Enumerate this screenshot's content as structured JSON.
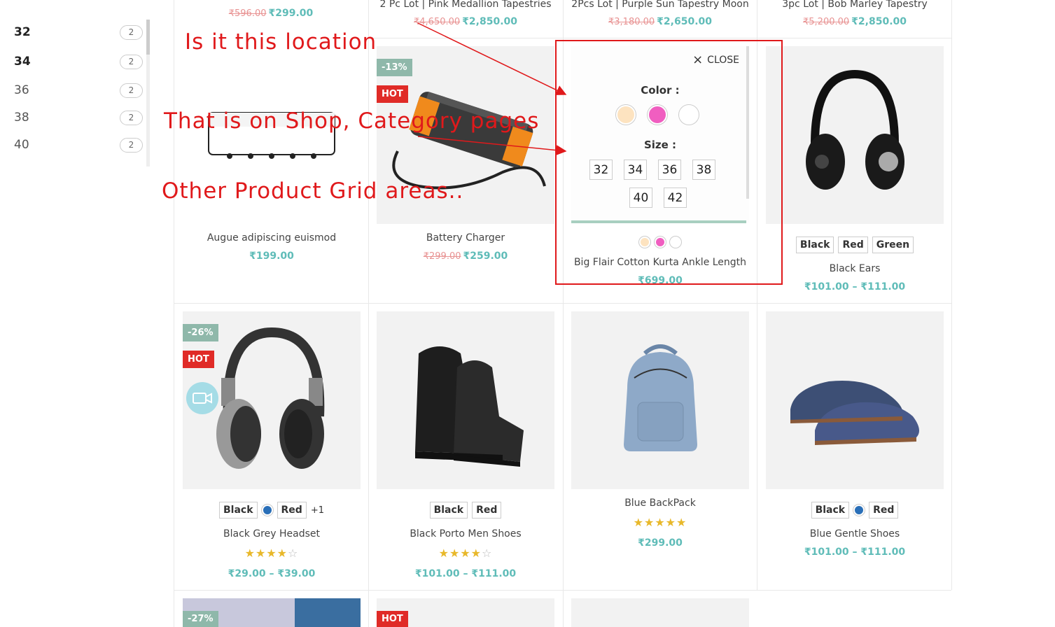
{
  "sidebar": {
    "sizes": [
      {
        "label": "32",
        "count": "2"
      },
      {
        "label": "34",
        "count": "2"
      },
      {
        "label": "36",
        "count": "2"
      },
      {
        "label": "38",
        "count": "2"
      },
      {
        "label": "40",
        "count": "2"
      }
    ]
  },
  "top_row": [
    {
      "name": "",
      "old_price": "₹596.00",
      "price": "₹299.00"
    },
    {
      "name": "2 Pc Lot | Pink Medallion Tapestries",
      "old_price": "₹4,650.00",
      "price": "₹2,850.00"
    },
    {
      "name": "2Pcs Lot | Purple Sun Tapestry Moon",
      "old_price": "₹3,180.00",
      "price": "₹2,650.00"
    },
    {
      "name": "3pc Lot | Bob Marley Tapestry",
      "old_price": "₹5,200.00",
      "price": "₹2,850.00"
    }
  ],
  "row2": [
    {
      "name": "Augue adipiscing euismod",
      "old_price": "",
      "price": "₹199.00"
    },
    {
      "name": "Battery Charger",
      "badge_discount": "-13%",
      "badge_hot": "HOT",
      "old_price": "₹299.00",
      "price": "₹259.00"
    },
    {
      "name": "Big Flair Cotton Kurta Ankle Length",
      "price": "₹699.00",
      "swatch_colors": [
        "#fde3c0",
        "#f05ec0",
        "#ffffff"
      ]
    },
    {
      "name": "Black Ears",
      "swatches": [
        "Black",
        "Red",
        "Green"
      ],
      "price": "₹101.00 – ₹111.00"
    }
  ],
  "quick_view": {
    "close_label": "CLOSE",
    "color_label": "Color :",
    "size_label": "Size :",
    "colors": [
      "#fde3c0",
      "#f05ec0",
      "#ffffff"
    ],
    "sizes": [
      "32",
      "34",
      "36",
      "38",
      "40",
      "42"
    ]
  },
  "row3": [
    {
      "name": "Black Grey Headset",
      "badge_discount": "-26%",
      "badge_hot": "HOT",
      "swatch_a": "Black",
      "swatch_b": "Red",
      "more": "+1",
      "dot_color": "#2a6fb8",
      "rating": 4,
      "price": "₹29.00 – ₹39.00"
    },
    {
      "name": "Black Porto Men Shoes",
      "swatch_a": "Black",
      "swatch_b": "Red",
      "rating": 4,
      "price": "₹101.00 – ₹111.00"
    },
    {
      "name": "Blue BackPack",
      "rating": 5,
      "price": "₹299.00"
    },
    {
      "name": "Blue Gentle Shoes",
      "swatch_a": "Black",
      "swatch_b": "Red",
      "dot_color": "#2a6fb8",
      "price": "₹101.00 – ₹111.00"
    }
  ],
  "row4": {
    "badge_discount": "-27%",
    "badge_hot": "HOT"
  },
  "annotations": {
    "line1": "Is it this location",
    "line2": "That is on Shop, Category pages",
    "line3": "Other Product Grid areas.."
  }
}
